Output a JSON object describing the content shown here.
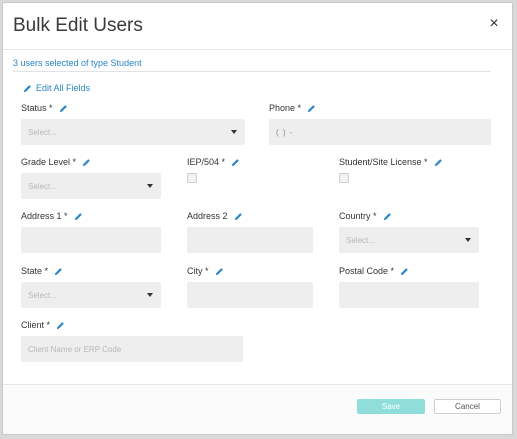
{
  "modal": {
    "title": "Bulk Edit Users",
    "close_glyph": "×",
    "selected_info": "3 users selected of type Student",
    "edit_all_label": "Edit All Fields"
  },
  "fields": {
    "status": {
      "label": "Status *",
      "placeholder": "Select..."
    },
    "phone": {
      "label": "Phone *",
      "value": "(   )   -"
    },
    "grade_level": {
      "label": "Grade Level *",
      "placeholder": "Select..."
    },
    "iep_504": {
      "label": "IEP/504 *"
    },
    "student_site_license": {
      "label": "Student/Site License *"
    },
    "address1": {
      "label": "Address 1 *"
    },
    "address2": {
      "label": "Address 2"
    },
    "country": {
      "label": "Country *",
      "placeholder": "Select..."
    },
    "state": {
      "label": "State *",
      "placeholder": "Select..."
    },
    "city": {
      "label": "City *"
    },
    "postal_code": {
      "label": "Postal Code *"
    },
    "client": {
      "label": "Client *",
      "placeholder": "Client Name or ERP Code"
    }
  },
  "footer": {
    "save_label": "Save",
    "cancel_label": "Cancel"
  },
  "colors": {
    "accent_blue": "#2a86c5",
    "save_teal_disabled": "#8fdedb",
    "input_bg": "#eeeeef"
  },
  "icons": [
    "close-icon",
    "pencil-icon",
    "caret-down-icon"
  ]
}
